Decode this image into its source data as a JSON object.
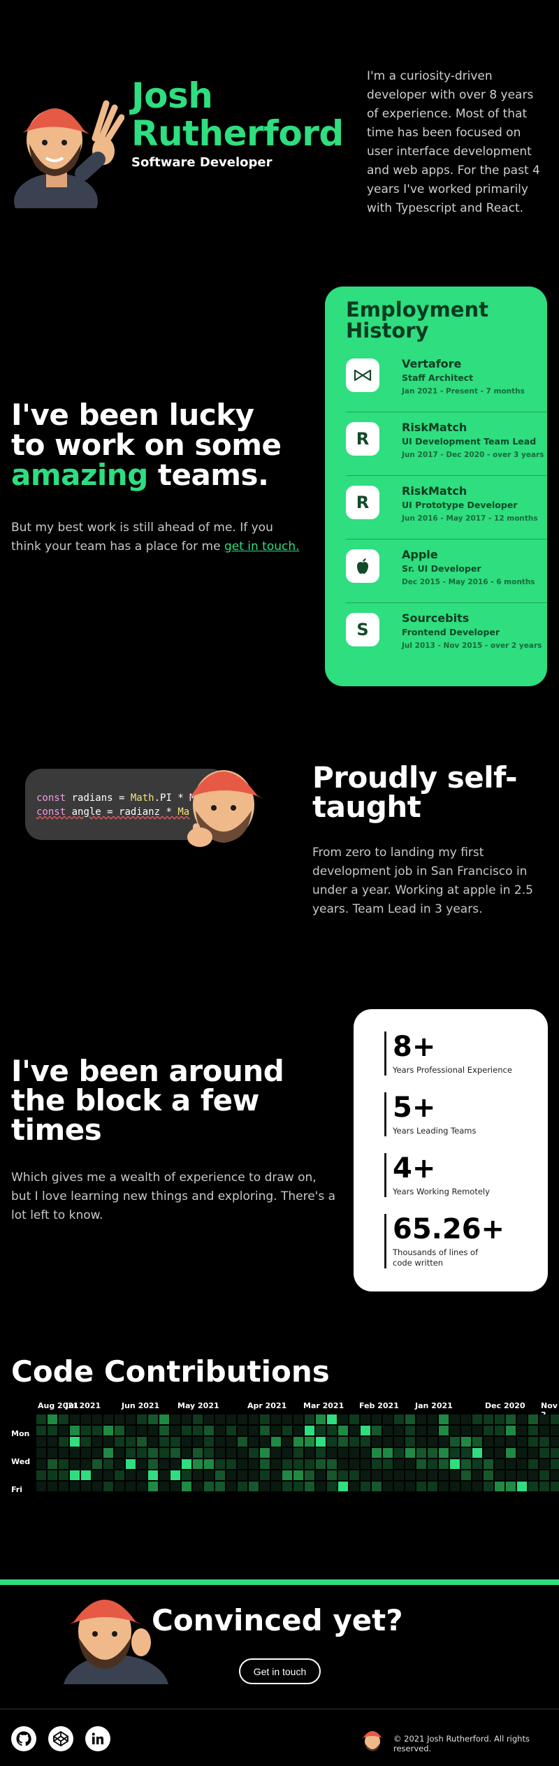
{
  "hero": {
    "first_name": "Josh",
    "last_name": "Rutherford",
    "role": "Software Developer",
    "bio": "I'm a curiosity-driven developer with over 8 years of experience. Most of that time has been focused on user interface development and web apps. For the past 4 years I've worked primarily with Typescript and React."
  },
  "teams": {
    "line1": "I've been lucky",
    "line2": "to work on some",
    "line3_accent": "amazing",
    "line3_rest": " teams.",
    "body": "But my best work is still ahead of me. If you think your team has a place for me ",
    "link": "get in touch."
  },
  "employment": {
    "title_line1": "Employment",
    "title_line2": "History",
    "items": [
      {
        "logo": "vertafore-logo-icon",
        "company": "Vertafore",
        "role": "Staff Architect",
        "dates": "Jan 2021 - Present - 7 months"
      },
      {
        "logo": "riskmatch-logo-icon",
        "company": "RiskMatch",
        "role": "UI Development Team Lead",
        "dates": "Jun 2017 - Dec 2020 - over 3 years"
      },
      {
        "logo": "riskmatch-logo-icon",
        "company": "RiskMatch",
        "role": "UI Prototype Developer",
        "dates": "Jun 2016 - May 2017 - 12 months"
      },
      {
        "logo": "apple-logo-icon",
        "company": "Apple",
        "role": "Sr. UI Developer",
        "dates": "Dec 2015 - May 2016 - 6 months"
      },
      {
        "logo": "sourcebits-logo-icon",
        "company": "Sourcebits",
        "role": "Frontend Developer",
        "dates": "Jul 2013 - Nov 2015 - over 2 years"
      }
    ]
  },
  "self_taught": {
    "title_line1": "Proudly self-",
    "title_line2": "taught",
    "body": "From zero to landing my first development job in San Francisco in under a year. Working at apple in 2.5 years. Team Lead in 3 years.",
    "code_line1": {
      "kw": "const",
      "rest1": " radians = ",
      "fn": "Math",
      "rest2": ".PI * M"
    },
    "code_line2": {
      "kw": "const",
      "rest1": " angle = radianz * ",
      "fn": "Ma"
    }
  },
  "experience": {
    "title_line1": "I've been around",
    "title_line2": "the block a few",
    "title_line3": "times",
    "body": "Which gives me a wealth of experience to draw on, but I love learning new things and exploring. There's a lot left to know.",
    "stats": [
      {
        "value": "8+",
        "label": "Years Professional Experience"
      },
      {
        "value": "5+",
        "label": "Years Leading Teams"
      },
      {
        "value": "4+",
        "label": "Years Working Remotely"
      },
      {
        "value": "65.26+",
        "label": "Thousands of lines of code written"
      }
    ]
  },
  "contributions": {
    "title": "Code Contributions",
    "months": [
      "Aug 2021",
      "Jul 2021",
      "Jun 2021",
      "May 2021",
      "Apr 2021",
      "Mar 2021",
      "Feb 2021",
      "Jan 2021",
      "Dec 2020",
      "Nov 2"
    ],
    "days": [
      "Mon",
      "Wed",
      "Fri"
    ],
    "colors": [
      "#0a1a10",
      "#0e3a1e",
      "#16572c",
      "#1f8a43",
      "#2ede7f"
    ]
  },
  "cta": {
    "title": "Convinced yet?",
    "button": "Get in touch"
  },
  "footer": {
    "copyright": "© 2021 Josh Rutherford. All rights reserved."
  },
  "colors": {
    "accent": "#2ede7f",
    "background": "#000000"
  }
}
